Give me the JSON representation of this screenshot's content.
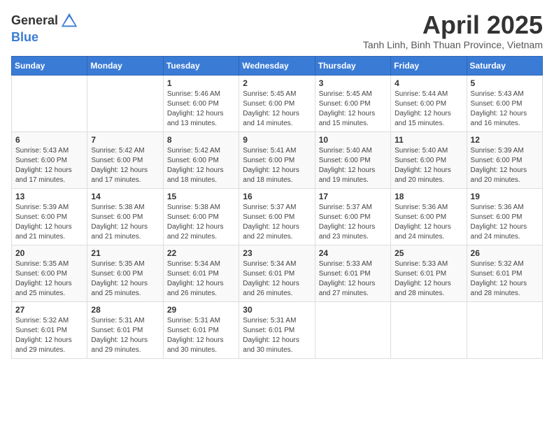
{
  "header": {
    "logo_line1": "General",
    "logo_line2": "Blue",
    "month_title": "April 2025",
    "location": "Tanh Linh, Binh Thuan Province, Vietnam"
  },
  "days_of_week": [
    "Sunday",
    "Monday",
    "Tuesday",
    "Wednesday",
    "Thursday",
    "Friday",
    "Saturday"
  ],
  "weeks": [
    [
      {
        "day": "",
        "info": ""
      },
      {
        "day": "",
        "info": ""
      },
      {
        "day": "1",
        "info": "Sunrise: 5:46 AM\nSunset: 6:00 PM\nDaylight: 12 hours\nand 13 minutes."
      },
      {
        "day": "2",
        "info": "Sunrise: 5:45 AM\nSunset: 6:00 PM\nDaylight: 12 hours\nand 14 minutes."
      },
      {
        "day": "3",
        "info": "Sunrise: 5:45 AM\nSunset: 6:00 PM\nDaylight: 12 hours\nand 15 minutes."
      },
      {
        "day": "4",
        "info": "Sunrise: 5:44 AM\nSunset: 6:00 PM\nDaylight: 12 hours\nand 15 minutes."
      },
      {
        "day": "5",
        "info": "Sunrise: 5:43 AM\nSunset: 6:00 PM\nDaylight: 12 hours\nand 16 minutes."
      }
    ],
    [
      {
        "day": "6",
        "info": "Sunrise: 5:43 AM\nSunset: 6:00 PM\nDaylight: 12 hours\nand 17 minutes."
      },
      {
        "day": "7",
        "info": "Sunrise: 5:42 AM\nSunset: 6:00 PM\nDaylight: 12 hours\nand 17 minutes."
      },
      {
        "day": "8",
        "info": "Sunrise: 5:42 AM\nSunset: 6:00 PM\nDaylight: 12 hours\nand 18 minutes."
      },
      {
        "day": "9",
        "info": "Sunrise: 5:41 AM\nSunset: 6:00 PM\nDaylight: 12 hours\nand 18 minutes."
      },
      {
        "day": "10",
        "info": "Sunrise: 5:40 AM\nSunset: 6:00 PM\nDaylight: 12 hours\nand 19 minutes."
      },
      {
        "day": "11",
        "info": "Sunrise: 5:40 AM\nSunset: 6:00 PM\nDaylight: 12 hours\nand 20 minutes."
      },
      {
        "day": "12",
        "info": "Sunrise: 5:39 AM\nSunset: 6:00 PM\nDaylight: 12 hours\nand 20 minutes."
      }
    ],
    [
      {
        "day": "13",
        "info": "Sunrise: 5:39 AM\nSunset: 6:00 PM\nDaylight: 12 hours\nand 21 minutes."
      },
      {
        "day": "14",
        "info": "Sunrise: 5:38 AM\nSunset: 6:00 PM\nDaylight: 12 hours\nand 21 minutes."
      },
      {
        "day": "15",
        "info": "Sunrise: 5:38 AM\nSunset: 6:00 PM\nDaylight: 12 hours\nand 22 minutes."
      },
      {
        "day": "16",
        "info": "Sunrise: 5:37 AM\nSunset: 6:00 PM\nDaylight: 12 hours\nand 22 minutes."
      },
      {
        "day": "17",
        "info": "Sunrise: 5:37 AM\nSunset: 6:00 PM\nDaylight: 12 hours\nand 23 minutes."
      },
      {
        "day": "18",
        "info": "Sunrise: 5:36 AM\nSunset: 6:00 PM\nDaylight: 12 hours\nand 24 minutes."
      },
      {
        "day": "19",
        "info": "Sunrise: 5:36 AM\nSunset: 6:00 PM\nDaylight: 12 hours\nand 24 minutes."
      }
    ],
    [
      {
        "day": "20",
        "info": "Sunrise: 5:35 AM\nSunset: 6:00 PM\nDaylight: 12 hours\nand 25 minutes."
      },
      {
        "day": "21",
        "info": "Sunrise: 5:35 AM\nSunset: 6:00 PM\nDaylight: 12 hours\nand 25 minutes."
      },
      {
        "day": "22",
        "info": "Sunrise: 5:34 AM\nSunset: 6:01 PM\nDaylight: 12 hours\nand 26 minutes."
      },
      {
        "day": "23",
        "info": "Sunrise: 5:34 AM\nSunset: 6:01 PM\nDaylight: 12 hours\nand 26 minutes."
      },
      {
        "day": "24",
        "info": "Sunrise: 5:33 AM\nSunset: 6:01 PM\nDaylight: 12 hours\nand 27 minutes."
      },
      {
        "day": "25",
        "info": "Sunrise: 5:33 AM\nSunset: 6:01 PM\nDaylight: 12 hours\nand 28 minutes."
      },
      {
        "day": "26",
        "info": "Sunrise: 5:32 AM\nSunset: 6:01 PM\nDaylight: 12 hours\nand 28 minutes."
      }
    ],
    [
      {
        "day": "27",
        "info": "Sunrise: 5:32 AM\nSunset: 6:01 PM\nDaylight: 12 hours\nand 29 minutes."
      },
      {
        "day": "28",
        "info": "Sunrise: 5:31 AM\nSunset: 6:01 PM\nDaylight: 12 hours\nand 29 minutes."
      },
      {
        "day": "29",
        "info": "Sunrise: 5:31 AM\nSunset: 6:01 PM\nDaylight: 12 hours\nand 30 minutes."
      },
      {
        "day": "30",
        "info": "Sunrise: 5:31 AM\nSunset: 6:01 PM\nDaylight: 12 hours\nand 30 minutes."
      },
      {
        "day": "",
        "info": ""
      },
      {
        "day": "",
        "info": ""
      },
      {
        "day": "",
        "info": ""
      }
    ]
  ]
}
